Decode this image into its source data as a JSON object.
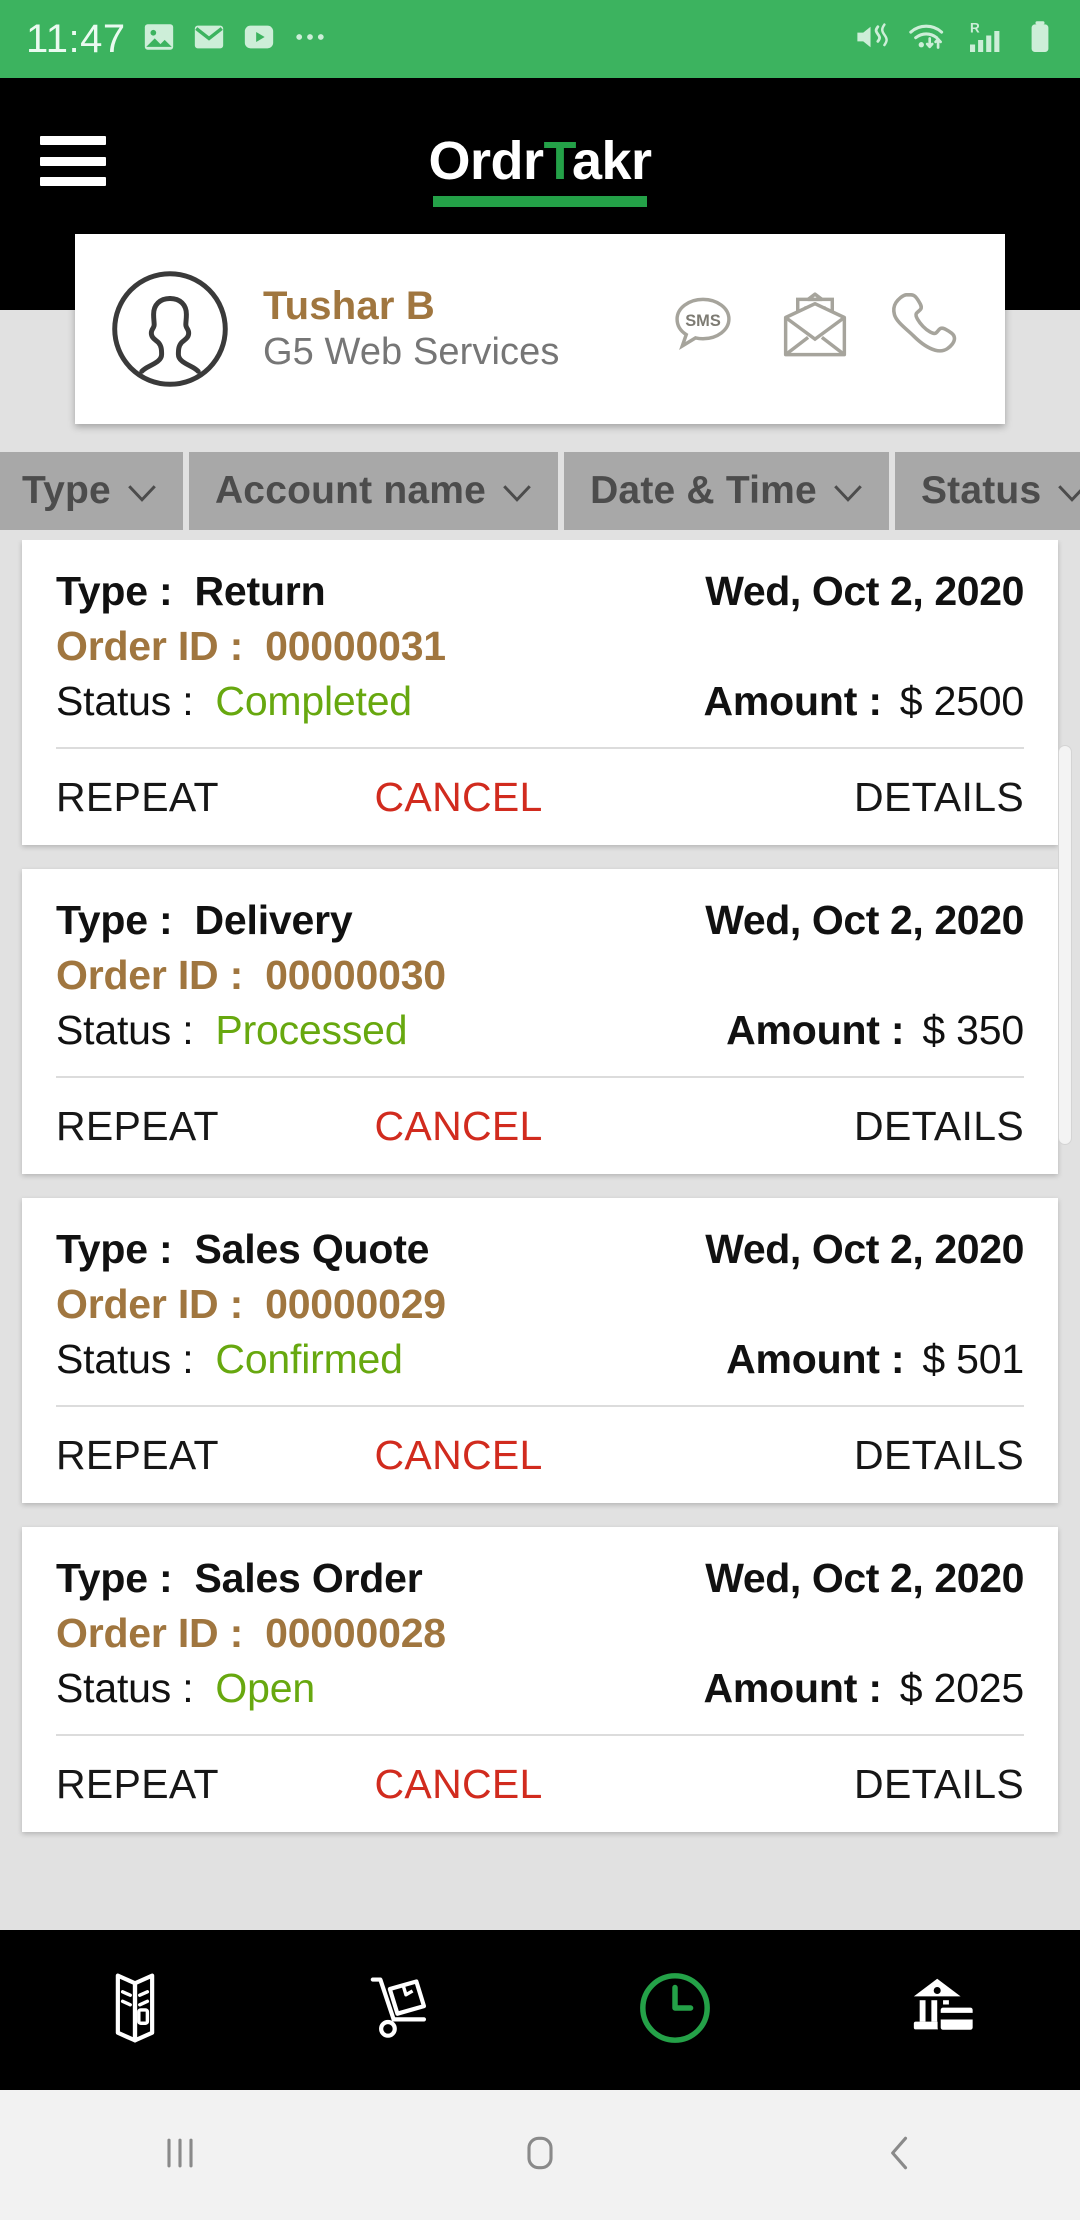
{
  "status_bar": {
    "time": "11:47",
    "left_icons": [
      "image-icon",
      "email-icon",
      "youtube-icon",
      "more-icon"
    ],
    "right_icons": [
      "mute-vibrate-icon",
      "wifi-icon",
      "signal-roaming-icon",
      "battery-icon"
    ],
    "background_color": "#3cb35f"
  },
  "header": {
    "menu_icon": "hamburger-menu-icon",
    "logo_part1": "Ordr",
    "logo_accent": "T",
    "logo_part2": "akr",
    "accent_color": "#24a148",
    "background_color": "#000000"
  },
  "profile": {
    "avatar_icon": "user-avatar-icon",
    "name": "Tushar B",
    "name_color": "#a0763f",
    "company": "G5 Web Services",
    "actions": [
      {
        "icon": "sms-icon",
        "label": "SMS"
      },
      {
        "icon": "email-envelope-icon",
        "label": "Email"
      },
      {
        "icon": "phone-call-icon",
        "label": "Call"
      }
    ]
  },
  "filters": [
    {
      "label": "Type",
      "icon": "chevron-down-icon"
    },
    {
      "label": "Account name",
      "icon": "chevron-down-icon"
    },
    {
      "label": "Date & Time",
      "icon": "chevron-down-icon"
    },
    {
      "label": "Status",
      "icon": "chevron-down-icon"
    }
  ],
  "labels": {
    "type": "Type :",
    "order_id": "Order ID :",
    "status": "Status :",
    "amount": "Amount :",
    "repeat": "REPEAT",
    "cancel": "CANCEL",
    "details": "DETAILS"
  },
  "colors": {
    "accent_green": "#24a148",
    "status_green": "#67a80f",
    "order_brown": "#a0763f",
    "cancel_red": "#d12b1e",
    "page_background": "#e1e1e1",
    "chip_background": "#a8a8a8"
  },
  "orders": [
    {
      "type": "Return",
      "date": "Wed, Oct 2, 2020",
      "order_id": "00000031",
      "status": "Completed",
      "amount": "$ 2500"
    },
    {
      "type": "Delivery",
      "date": "Wed, Oct 2, 2020",
      "order_id": "00000030",
      "status": "Processed",
      "amount": "$ 350"
    },
    {
      "type": "Sales Quote",
      "date": "Wed, Oct 2, 2020",
      "order_id": "00000029",
      "status": "Confirmed",
      "amount": "$ 501"
    },
    {
      "type": "Sales Order",
      "date": "Wed, Oct 2, 2020",
      "order_id": "00000028",
      "status": "Open",
      "amount": "$ 2025"
    }
  ],
  "bottom_nav": [
    {
      "icon": "catalog-book-icon",
      "active": false
    },
    {
      "icon": "hand-truck-delivery-icon",
      "active": false
    },
    {
      "icon": "clock-history-icon",
      "active": true
    },
    {
      "icon": "bank-payment-icon",
      "active": false
    }
  ],
  "android_nav": [
    {
      "icon": "recents-icon"
    },
    {
      "icon": "home-icon"
    },
    {
      "icon": "back-icon"
    }
  ]
}
